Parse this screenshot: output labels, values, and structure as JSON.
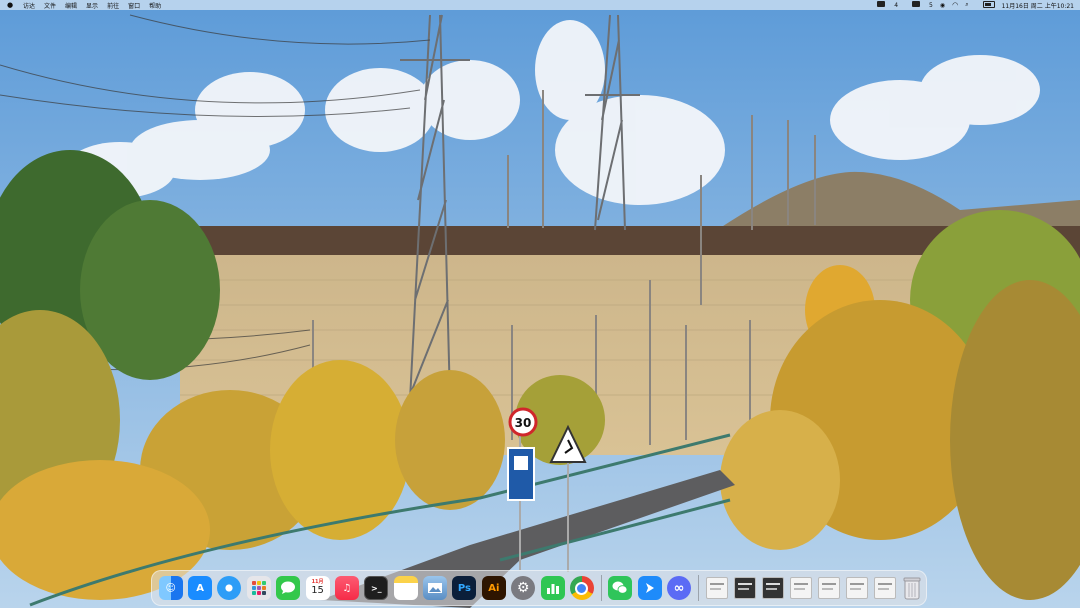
{
  "menubar": {
    "apple_icon": "apple-icon",
    "menus": [
      "访达",
      "文件",
      "编辑",
      "显示",
      "前往",
      "窗口",
      "帮助"
    ],
    "status": {
      "badge1": "4",
      "badge2": "5",
      "datetime": "11月16日 周二 上午10:21"
    }
  },
  "dock": {
    "apps": [
      {
        "name": "finder-icon",
        "label": "",
        "color": "#3d8ff5"
      },
      {
        "name": "app-store-icon",
        "label": "A",
        "color": "#1a8cff"
      },
      {
        "name": "safari-icon",
        "label": "",
        "color": "#2d9df7"
      },
      {
        "name": "launchpad-icon",
        "label": "",
        "color": "#e6e6ea"
      },
      {
        "name": "messages-icon",
        "label": "",
        "color": "#33c84b"
      },
      {
        "name": "calendar-icon",
        "label": "15",
        "color": "#ffffff"
      },
      {
        "name": "music-icon",
        "label": "♫",
        "color": "#fb3c56"
      },
      {
        "name": "terminal-icon",
        "label": ">_",
        "color": "#1e1e1e"
      },
      {
        "name": "notes-icon",
        "label": "",
        "color": "#fbd24a"
      },
      {
        "name": "preview-icon",
        "label": "",
        "color": "#7fb0e0"
      },
      {
        "name": "photoshop-icon",
        "label": "Ps",
        "color": "#0b1f3a"
      },
      {
        "name": "illustrator-icon",
        "label": "Ai",
        "color": "#2e1500"
      },
      {
        "name": "system-preferences-icon",
        "label": "⚙",
        "color": "#7a7a80"
      },
      {
        "name": "numbers-icon",
        "label": "",
        "color": "#2fc653"
      },
      {
        "name": "chrome-icon",
        "label": "",
        "color": "#ffffff"
      },
      {
        "name": "wechat-icon",
        "label": "",
        "color": "#2fc55a"
      },
      {
        "name": "feishu-icon",
        "label": "",
        "color": "#1e8bfa"
      },
      {
        "name": "link-app-icon",
        "label": "∞",
        "color": "#5b6bf5"
      }
    ],
    "calendar_month": "11月"
  }
}
